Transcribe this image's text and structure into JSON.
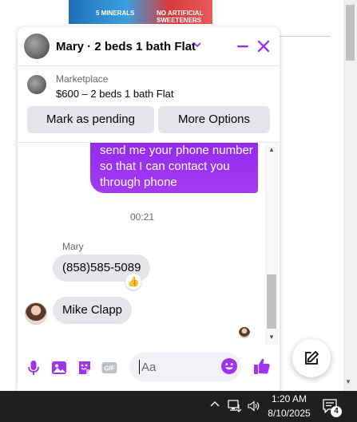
{
  "ad": {
    "chip_left": "5 MINERALS",
    "chip_right": "NO ARTIFICIAL SWEETENERS"
  },
  "chat": {
    "title": "Mary · 2 beds 1 bath Flat",
    "accent_color": "#a033f0",
    "listing": {
      "source": "Marketplace",
      "title": "$600 – 2 beds 1 bath Flat",
      "primary_action": "Mark as pending",
      "secondary_action": "More Options"
    },
    "messages": [
      {
        "direction": "outgoing",
        "text": "send me your phone number so that I can contact you through phone"
      },
      {
        "type": "timestamp",
        "text": "00:21"
      },
      {
        "direction": "incoming",
        "sender": "Mary",
        "text": "(858)585-5089",
        "reaction": "👍"
      },
      {
        "direction": "incoming",
        "text": "Mike Clapp"
      }
    ],
    "composer": {
      "placeholder": "Aa"
    },
    "icons": [
      "microphone-icon",
      "image-icon",
      "sticker-icon",
      "gif-icon",
      "emoji-icon",
      "thumbs-up-icon",
      "minimize-icon",
      "close-icon",
      "chevron-down-icon"
    ]
  },
  "taskbar": {
    "time": "1:20 AM",
    "date": "8/10/2025",
    "notification_count": "4"
  }
}
